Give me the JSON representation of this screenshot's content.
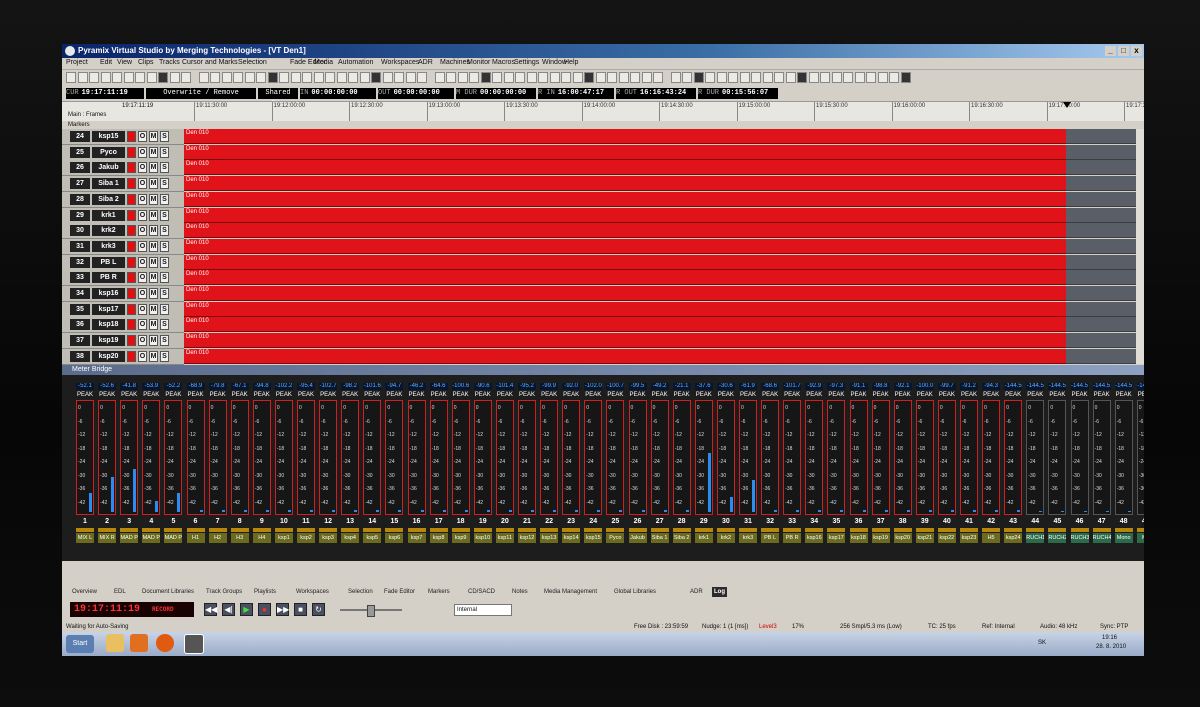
{
  "window": {
    "title": "Pyramix Virtual Studio by Merging Technologies - [VT Den1]",
    "controls": [
      "_",
      "□",
      "x"
    ]
  },
  "menu": [
    "Project",
    "Edit",
    "View",
    "Clips",
    "Tracks",
    "Cursor and Marks",
    "Selection",
    "Fade Editor",
    "Media",
    "Automation",
    "Workspaces",
    "ADR",
    "Machines",
    "Monitor",
    "Macros",
    "Settings",
    "Window",
    "Help"
  ],
  "timecode": {
    "cur_label": "CUR",
    "cur": "19:17:11:19",
    "mode": "Overwrite / Remove",
    "mix": "Shared Mix",
    "in_label": "IN",
    "in": "00:00:00:00",
    "out_label": "OUT",
    "out": "00:00:00:00",
    "mdur_label": "M DUR",
    "mdur": "00:00:00:00",
    "rin_label": "R IN",
    "rin": "16:00:47:17",
    "rout_label": "R OUT",
    "rout": "16:16:43:24",
    "rdur_label": "R DUR",
    "rdur": "00:15:56:07"
  },
  "ruler": {
    "label": "Main : Frames",
    "cursor_tc": "19:17:11:19",
    "ticks": [
      "19:11:30:00",
      "19:12:00:00",
      "19:12:30:00",
      "19:13:00:00",
      "19:13:30:00",
      "19:14:00:00",
      "19:14:30:00",
      "19:15:00:00",
      "19:15:30:00",
      "19:16:00:00",
      "19:16:30:00",
      "19:17:00:00",
      "19:17:3"
    ],
    "markers_label": "Markers"
  },
  "tracks": [
    {
      "num": "24",
      "name": "ksp15",
      "clip": "Den 010"
    },
    {
      "num": "25",
      "name": "Pyco",
      "clip": "Den 010"
    },
    {
      "num": "26",
      "name": "Jakub",
      "clip": "Den 010"
    },
    {
      "num": "27",
      "name": "Siba 1",
      "clip": "Den 010"
    },
    {
      "num": "28",
      "name": "Siba 2",
      "clip": "Den 010"
    },
    {
      "num": "29",
      "name": "krk1",
      "clip": "Den 010"
    },
    {
      "num": "30",
      "name": "krk2",
      "clip": "Den 010"
    },
    {
      "num": "31",
      "name": "krk3",
      "clip": "Den 010"
    },
    {
      "num": "32",
      "name": "PB L",
      "clip": "Den 010"
    },
    {
      "num": "33",
      "name": "PB R",
      "clip": "Den 010"
    },
    {
      "num": "34",
      "name": "ksp16",
      "clip": "Den 010"
    },
    {
      "num": "35",
      "name": "ksp17",
      "clip": "Den 010"
    },
    {
      "num": "36",
      "name": "ksp18",
      "clip": "Den 010"
    },
    {
      "num": "37",
      "name": "ksp19",
      "clip": "Den 010"
    },
    {
      "num": "38",
      "name": "ksp20",
      "clip": "Den 010"
    }
  ],
  "track_buttons": [
    "O",
    "M",
    "S"
  ],
  "meter": {
    "title": "Meter Bridge",
    "peak_label": "PEAK",
    "scale": [
      "0",
      "-6",
      "-12",
      "-18",
      "-24",
      "-30",
      "-36",
      "-42"
    ],
    "channels": [
      {
        "num": "1",
        "name": "MIX L",
        "peak": "-52.1",
        "level": 0.18
      },
      {
        "num": "2",
        "name": "MIX R",
        "peak": "-52.6",
        "level": 0.32
      },
      {
        "num": "3",
        "name": "MAD P",
        "peak": "-41.8",
        "level": 0.4
      },
      {
        "num": "4",
        "name": "MAD P",
        "peak": "-53.9",
        "level": 0.1
      },
      {
        "num": "5",
        "name": "MAD P",
        "peak": "-52.2",
        "level": 0.18
      },
      {
        "num": "6",
        "name": "H1",
        "peak": "-68.9",
        "level": 0.02
      },
      {
        "num": "7",
        "name": "H2",
        "peak": "-79.8",
        "level": 0.02
      },
      {
        "num": "8",
        "name": "H3",
        "peak": "-67.1",
        "level": 0.02
      },
      {
        "num": "9",
        "name": "H4",
        "peak": "-94.8",
        "level": 0.02
      },
      {
        "num": "10",
        "name": "ksp1",
        "peak": "-102.2",
        "level": 0.02
      },
      {
        "num": "11",
        "name": "ksp2",
        "peak": "-95.4",
        "level": 0.02
      },
      {
        "num": "12",
        "name": "ksp3",
        "peak": "-102.7",
        "level": 0.02
      },
      {
        "num": "13",
        "name": "ksp4",
        "peak": "-98.2",
        "level": 0.02
      },
      {
        "num": "14",
        "name": "ksp5",
        "peak": "-101.6",
        "level": 0.02
      },
      {
        "num": "15",
        "name": "ksp6",
        "peak": "-94.7",
        "level": 0.02
      },
      {
        "num": "16",
        "name": "ksp7",
        "peak": "-46.2",
        "level": 0.02
      },
      {
        "num": "17",
        "name": "ksp8",
        "peak": "-64.6",
        "level": 0.02
      },
      {
        "num": "18",
        "name": "ksp9",
        "peak": "-100.6",
        "level": 0.02
      },
      {
        "num": "19",
        "name": "ksp10",
        "peak": "-90.6",
        "level": 0.02
      },
      {
        "num": "20",
        "name": "ksp11",
        "peak": "-101.4",
        "level": 0.02
      },
      {
        "num": "21",
        "name": "ksp12",
        "peak": "-95.2",
        "level": 0.02
      },
      {
        "num": "22",
        "name": "ksp13",
        "peak": "-99.9",
        "level": 0.02
      },
      {
        "num": "23",
        "name": "ksp14",
        "peak": "-92.0",
        "level": 0.02
      },
      {
        "num": "24",
        "name": "ksp15",
        "peak": "-102.0",
        "level": 0.02
      },
      {
        "num": "25",
        "name": "Pyco",
        "peak": "-100.7",
        "level": 0.02
      },
      {
        "num": "26",
        "name": "Jakub",
        "peak": "-99.5",
        "level": 0.02
      },
      {
        "num": "27",
        "name": "Siba 1",
        "peak": "-49.2",
        "level": 0.02
      },
      {
        "num": "28",
        "name": "Siba 2",
        "peak": "-21.1",
        "level": 0.02
      },
      {
        "num": "29",
        "name": "krk1",
        "peak": "-37.6",
        "level": 0.55
      },
      {
        "num": "30",
        "name": "krk2",
        "peak": "-30.6",
        "level": 0.14
      },
      {
        "num": "31",
        "name": "krk3",
        "peak": "-61.9",
        "level": 0.3
      },
      {
        "num": "32",
        "name": "PB L",
        "peak": "-68.6",
        "level": 0.02
      },
      {
        "num": "33",
        "name": "PB R",
        "peak": "-101.7",
        "level": 0.02
      },
      {
        "num": "34",
        "name": "ksp16",
        "peak": "-92.9",
        "level": 0.02
      },
      {
        "num": "35",
        "name": "ksp17",
        "peak": "-97.3",
        "level": 0.02
      },
      {
        "num": "36",
        "name": "ksp18",
        "peak": "-91.1",
        "level": 0.02
      },
      {
        "num": "37",
        "name": "ksp19",
        "peak": "-98.8",
        "level": 0.02
      },
      {
        "num": "38",
        "name": "ksp20",
        "peak": "-92.1",
        "level": 0.02
      },
      {
        "num": "39",
        "name": "ksp21",
        "peak": "-100.0",
        "level": 0.02
      },
      {
        "num": "40",
        "name": "ksp22",
        "peak": "-99.7",
        "level": 0.02
      },
      {
        "num": "41",
        "name": "ksp23",
        "peak": "-91.2",
        "level": 0.02
      },
      {
        "num": "42",
        "name": "H5",
        "peak": "-94.3",
        "level": 0.02
      },
      {
        "num": "43",
        "name": "ksp24",
        "peak": "-144.5",
        "level": 0.02
      },
      {
        "num": "44",
        "name": "RUCH1",
        "peak": "-144.5",
        "level": 0.0
      },
      {
        "num": "45",
        "name": "RUCH2",
        "peak": "-144.5",
        "level": 0.0
      },
      {
        "num": "46",
        "name": "RUCH3",
        "peak": "-144.5",
        "level": 0.0
      },
      {
        "num": "47",
        "name": "RUCH4",
        "peak": "-144.5",
        "level": 0.0
      },
      {
        "num": "48",
        "name": "Mono",
        "peak": "-144.5",
        "level": 0.0
      },
      {
        "num": "49",
        "name": "Mo",
        "peak": "-144.5",
        "level": 0.0
      }
    ]
  },
  "tabs": [
    "Overview",
    "EDL",
    "Document Libraries",
    "Track Groups",
    "Playlists",
    "Workspaces",
    "Selection",
    "Fade Editor",
    "Markers",
    "CD/SACD",
    "Notes",
    "Media Management",
    "Global Libraries",
    "ADR",
    "Log"
  ],
  "transport": {
    "tc": "19:17:11:19",
    "state": "RECORD",
    "sync_source": "Internal",
    "buttons": [
      "◀◀",
      "◀|",
      "▶",
      "●",
      "▶▶",
      "■",
      "↻"
    ]
  },
  "status": {
    "msg": "Waiting for Auto-Saving",
    "disk": "Free Disk : 23:59:59",
    "nudge": "Nudge: 1 (1 [ms])",
    "level": "Level3",
    "cpu": "17%",
    "smpl": "256 Smpl/5.3 ms (Low)",
    "tc": "TC: 25 fps",
    "ref": "Ref: Internal",
    "audio": "Audio: 48 kHz",
    "sync": "Sync: PTP"
  },
  "taskbar": {
    "start": "Start",
    "lang": "SK",
    "time": "19:16",
    "date": "28. 8. 2010"
  }
}
